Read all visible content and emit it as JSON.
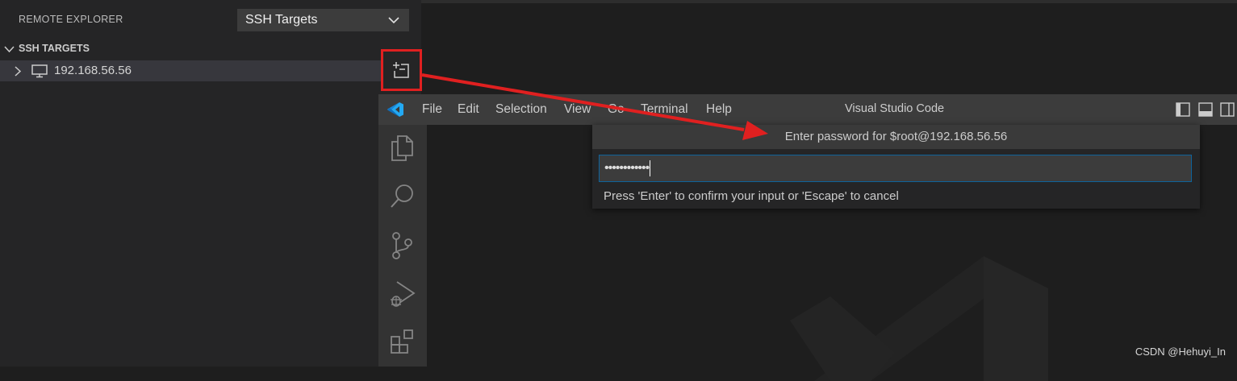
{
  "explorer": {
    "title": "REMOTE EXPLORER",
    "selected_target": "SSH Targets",
    "section_label": "SSH TARGETS",
    "hosts": [
      {
        "label": "192.168.56.56"
      }
    ]
  },
  "vscode_window": {
    "menu": [
      "File",
      "Edit",
      "Selection",
      "View",
      "Go",
      "Terminal",
      "Help"
    ],
    "title": "Visual Studio Code"
  },
  "quick_input": {
    "prompt": "Enter password for $root@192.168.56.56",
    "masked_value": "••••••••••••",
    "message": "Press 'Enter' to confirm your input or 'Escape' to cancel"
  },
  "credit": "CSDN @Hehuyi_In",
  "colors": {
    "annotation": "#e02020",
    "vscode_blue": "#23a9f2",
    "focus_border": "#0e639c"
  },
  "icons": {
    "host": "monitor-icon",
    "action": "new-window-icon",
    "activity": [
      "explorer-icon",
      "search-icon",
      "source-control-icon",
      "run-debug-icon",
      "extensions-icon"
    ]
  }
}
